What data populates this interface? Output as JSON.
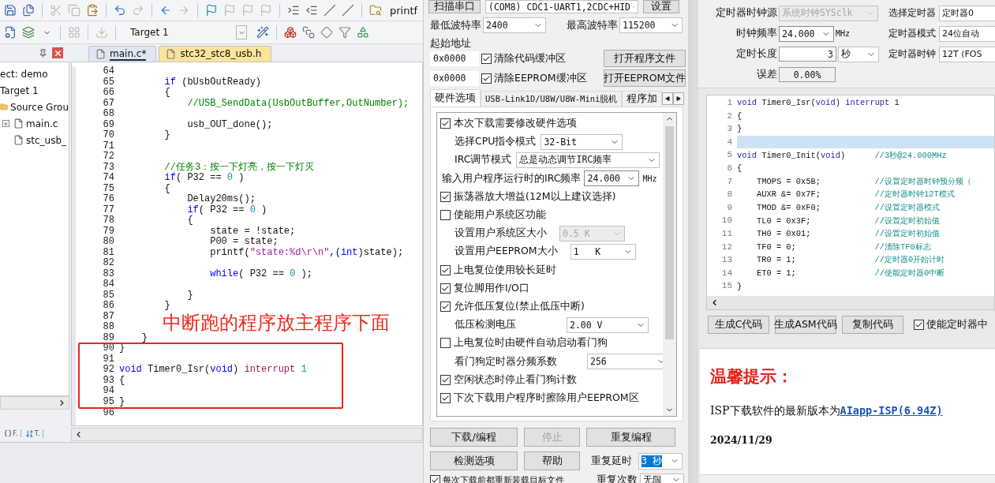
{
  "ide": {
    "toolbar_1": {
      "buttons": [
        {
          "disabled": false
        },
        {
          "disabled": false
        },
        {
          "disabled": true
        },
        {
          "disabled": true
        },
        {
          "disabled": false
        },
        {
          "disabled": false
        },
        {
          "disabled": true
        },
        {
          "disabled": false
        },
        {
          "disabled": true
        },
        {
          "disabled": false
        },
        {
          "disabled": true
        },
        {
          "disabled": true
        },
        {
          "disabled": true
        },
        {
          "disabled": false
        },
        {
          "disabled": false
        },
        {
          "disabled": false
        },
        {
          "disabled": false
        },
        {
          "disabled": false
        }
      ],
      "find_text": "printf"
    },
    "toolbar_2": {
      "buttons": [
        {
          "disabled": false
        },
        {
          "disabled": false
        },
        {
          "disabled": false
        },
        {
          "disabled": true
        },
        {
          "disabled": true
        },
        {
          "disabled": false
        },
        {
          "disabled": false
        },
        {
          "disabled": false
        },
        {
          "disabled": false
        },
        {
          "disabled": false
        },
        {
          "disabled": false
        }
      ],
      "target": "Target 1"
    },
    "project_tree": [
      {
        "label": "ect: demo",
        "children": [
          {
            "label": "Target 1",
            "children": [
              {
                "label": "Source Grou",
                "kind": "folder",
                "children": [
                  {
                    "label": "main.c",
                    "kind": "file",
                    "expandable": true
                  },
                  {
                    "label": "stc_usb_",
                    "kind": "file",
                    "expandable": false
                  }
                ]
              }
            ]
          }
        ]
      }
    ],
    "panel_tabs": [
      {
        "label": "F.",
        "kind": "functions"
      },
      {
        "label": "T.",
        "kind": "templates"
      }
    ],
    "editor_tabs": [
      {
        "label": "main.c*",
        "selected": true,
        "color": "#dfe6f2"
      },
      {
        "label": "stc32_stc8_usb.h",
        "selected": false,
        "color": "#fbe39a"
      }
    ],
    "code": [
      {
        "num": "64"
      },
      {
        "num": "65",
        "tokens": [
          {
            "kind": "kw",
            "text": "        if"
          },
          {
            "kind": "plain",
            "text": " (bUsbOutReady)"
          }
        ]
      },
      {
        "num": "66",
        "tokens": [
          {
            "kind": "plain",
            "text": "        {"
          }
        ]
      },
      {
        "num": "67",
        "tokens": [
          {
            "kind": "comment",
            "text": "            //USB_SendData(UsbOutBuffer,OutNumber);"
          }
        ]
      },
      {
        "num": "68"
      },
      {
        "num": "69",
        "tokens": [
          {
            "kind": "plain",
            "text": "            usb_OUT_done();"
          }
        ]
      },
      {
        "num": "70",
        "tokens": [
          {
            "kind": "plain",
            "text": "        }"
          }
        ]
      },
      {
        "num": "71"
      },
      {
        "num": "72"
      },
      {
        "num": "73",
        "tokens": [
          {
            "kind": "comment",
            "text": "        //任务3：按一下灯亮，按一下灯灭"
          }
        ]
      },
      {
        "num": "74",
        "tokens": [
          {
            "kind": "kw",
            "text": "        if"
          },
          {
            "kind": "plain",
            "text": "( P32 == "
          },
          {
            "kind": "num",
            "text": "0"
          },
          {
            "kind": "plain",
            "text": " )"
          }
        ]
      },
      {
        "num": "75",
        "tokens": [
          {
            "kind": "plain",
            "text": "        {"
          }
        ]
      },
      {
        "num": "76",
        "tokens": [
          {
            "kind": "plain",
            "text": "            Delay20ms();"
          }
        ]
      },
      {
        "num": "77",
        "tokens": [
          {
            "kind": "kw",
            "text": "            if"
          },
          {
            "kind": "plain",
            "text": "( P32 == "
          },
          {
            "kind": "num",
            "text": "0"
          },
          {
            "kind": "plain",
            "text": " )"
          }
        ]
      },
      {
        "num": "78",
        "tokens": [
          {
            "kind": "plain",
            "text": "            {"
          }
        ]
      },
      {
        "num": "79",
        "tokens": [
          {
            "kind": "plain",
            "text": "                state = !state;"
          }
        ]
      },
      {
        "num": "80",
        "tokens": [
          {
            "kind": "plain",
            "text": "                P00 = state;"
          }
        ]
      },
      {
        "num": "81",
        "tokens": [
          {
            "kind": "plain",
            "text": "                printf("
          },
          {
            "kind": "str",
            "text": "\"state:%d\\r\\n\""
          },
          {
            "kind": "plain",
            "text": ",("
          },
          {
            "kind": "kw",
            "text": "int"
          },
          {
            "kind": "plain",
            "text": ")state);"
          }
        ]
      },
      {
        "num": "82"
      },
      {
        "num": "83",
        "tokens": [
          {
            "kind": "kw",
            "text": "                while"
          },
          {
            "kind": "plain",
            "text": "( P32 == "
          },
          {
            "kind": "num",
            "text": "0"
          },
          {
            "kind": "plain",
            "text": " );"
          }
        ]
      },
      {
        "num": "84"
      },
      {
        "num": "85",
        "tokens": [
          {
            "kind": "plain",
            "text": "            }"
          }
        ]
      },
      {
        "num": "86",
        "tokens": [
          {
            "kind": "plain",
            "text": "        }"
          }
        ]
      },
      {
        "num": "87"
      },
      {
        "num": "88"
      },
      {
        "num": "89",
        "tokens": [
          {
            "kind": "plain",
            "text": "    }"
          }
        ]
      },
      {
        "num": "90",
        "tokens": [
          {
            "kind": "plain",
            "text": "}"
          }
        ]
      },
      {
        "num": "91"
      },
      {
        "num": "92",
        "tokens": [
          {
            "kind": "kw",
            "text": "void"
          },
          {
            "kind": "plain",
            "text": " Timer0_Isr("
          },
          {
            "kind": "kw",
            "text": "void"
          },
          {
            "kind": "plain",
            "text": ") "
          },
          {
            "kind": "kw2",
            "text": "interrupt"
          },
          {
            "kind": "num",
            "text": " 1"
          }
        ]
      },
      {
        "num": "93",
        "tokens": [
          {
            "kind": "plain",
            "text": "{"
          }
        ]
      },
      {
        "num": "94"
      },
      {
        "num": "95",
        "tokens": [
          {
            "kind": "plain",
            "text": "}"
          }
        ]
      },
      {
        "num": "96"
      }
    ],
    "annotation": "中断跑的程序放主程序下面"
  },
  "isp": {
    "scan_button": "扫描串口",
    "port": "(COM8) CDC1-UART1,2CDC+HID",
    "settings_button": "设置",
    "min_baud_label": "最低波特率",
    "min_baud": "2400",
    "max_baud_label": "最高波特率",
    "max_baud": "115200",
    "start_address_label": "起始地址",
    "address_rows": [
      {
        "address": "0x0000",
        "option": "清除代码缓冲区",
        "checked": true,
        "button": "打开程序文件"
      },
      {
        "address": "0x0000",
        "option": "清除EEPROM缓冲区",
        "checked": true,
        "button": "打开EEPROM文件"
      }
    ],
    "tabs": [
      {
        "label": "硬件选项",
        "selected": true
      },
      {
        "label": "USB-Link1D/U8W/U8W-Mini脱机",
        "selected": false
      },
      {
        "label": "程序加",
        "selected": false
      }
    ],
    "options": [
      {
        "kind": "checkbox",
        "label": "本次下载需要修改硬件选项",
        "checked": true
      },
      {
        "kind": "select",
        "label": "选择CPU指令模式",
        "value": "32-Bit",
        "disabled": false
      },
      {
        "kind": "select",
        "label": "IRC调节模式",
        "value": "总是动态调节IRC频率",
        "disabled": false
      },
      {
        "kind": "combo",
        "label": "输入用户程序运行时的IRC频率",
        "value": "24.000",
        "unit": "MHz"
      },
      {
        "kind": "checkbox",
        "label": "振荡器放大增益(12M以上建议选择)",
        "checked": true
      },
      {
        "kind": "checkbox",
        "label": "使能用户系统区功能",
        "checked": false
      },
      {
        "kind": "select",
        "label": "设置用户系统区大小",
        "value": "0.5 K",
        "disabled": true
      },
      {
        "kind": "select",
        "label": "设置用户EEPROM大小",
        "value": "1   K",
        "disabled": false
      },
      {
        "kind": "checkbox",
        "label": "上电复位使用较长延时",
        "checked": true
      },
      {
        "kind": "checkbox",
        "label": "复位脚用作I/O口",
        "checked": true
      },
      {
        "kind": "checkbox",
        "label": "允许低压复位(禁止低压中断)",
        "checked": true
      },
      {
        "kind": "select",
        "label": "低压检测电压",
        "value": "2.00 V",
        "disabled": false
      },
      {
        "kind": "checkbox",
        "label": "上电复位时由硬件自动启动看门狗",
        "checked": false
      },
      {
        "kind": "select",
        "label": "看门狗定时器分频系数",
        "value": "256",
        "disabled": false
      },
      {
        "kind": "checkbox",
        "label": "空闲状态时停止看门狗计数",
        "checked": true
      },
      {
        "kind": "checkbox",
        "label": "下次下载用户程序时擦除用户EEPROM区",
        "checked": true
      }
    ],
    "buttons": [
      {
        "label": "下载/编程",
        "disabled": false
      },
      {
        "label": "停止",
        "disabled": true
      },
      {
        "label": "重复编程",
        "disabled": false
      },
      {
        "label": "检测选项",
        "disabled": false
      },
      {
        "label": "帮助",
        "disabled": false
      }
    ],
    "repeat_delay": {
      "label": "重复延时",
      "value": "3 秒",
      "highlighted": true
    },
    "reload_option": {
      "label": "每次下载前都重新装载目标文件",
      "checked": true
    },
    "repeat_count": {
      "label": "重复次数",
      "value": "无限"
    }
  },
  "timer": {
    "fields_left": [
      {
        "kind": "select",
        "label": "定时器时钟源",
        "value": "系统时钟SYSclk",
        "disabled": true
      },
      {
        "kind": "combo",
        "label": "时钟频率",
        "value": "24.000",
        "unit": "MHz"
      },
      {
        "kind": "length",
        "label": "定时长度",
        "value": "3",
        "unit": "秒"
      },
      {
        "kind": "readout",
        "label": "误差",
        "value": "0.00%"
      }
    ],
    "fields_right": [
      {
        "label": "选择定时器",
        "value": "定时器0"
      },
      {
        "label": "定时器模式",
        "value": "24位自动"
      },
      {
        "label": "定时器时钟",
        "value": "12T (FOS"
      }
    ],
    "code": [
      {
        "num": "1",
        "highlighted": false,
        "tokens": [
          {
            "kind": "kw",
            "text": "void"
          },
          {
            "kind": "plain",
            "text": " Timer0_Isr("
          },
          {
            "kind": "kw",
            "text": "void"
          },
          {
            "kind": "plain",
            "text": ") "
          },
          {
            "kind": "kw",
            "text": "interrupt"
          },
          {
            "kind": "plain",
            "text": " 1"
          }
        ]
      },
      {
        "num": "2",
        "highlighted": false,
        "tokens": [
          {
            "kind": "plain",
            "text": "{"
          }
        ]
      },
      {
        "num": "3",
        "highlighted": false,
        "tokens": [
          {
            "kind": "plain",
            "text": "}"
          }
        ]
      },
      {
        "num": "4",
        "highlighted": true
      },
      {
        "num": "5",
        "highlighted": false,
        "tokens": [
          {
            "kind": "kw",
            "text": "void"
          },
          {
            "kind": "plain",
            "text": " Timer0_Init("
          },
          {
            "kind": "kw",
            "text": "void"
          },
          {
            "kind": "plain",
            "text": ")      "
          },
          {
            "kind": "comment",
            "text": "//3秒@24.000MHz"
          }
        ]
      },
      {
        "num": "6",
        "highlighted": false,
        "tokens": [
          {
            "kind": "plain",
            "text": "{"
          }
        ]
      },
      {
        "num": "7",
        "highlighted": false,
        "tokens": [
          {
            "kind": "plain",
            "text": "    TMOPS = 0x5B;           "
          },
          {
            "kind": "comment",
            "text": "//设置定时器时钟预分频（"
          }
        ]
      },
      {
        "num": "8",
        "highlighted": false,
        "tokens": [
          {
            "kind": "plain",
            "text": "    AUXR &= 0x7F;           "
          },
          {
            "kind": "comment",
            "text": "//定时器时钟12T模式"
          }
        ]
      },
      {
        "num": "9",
        "highlighted": false,
        "tokens": [
          {
            "kind": "plain",
            "text": "    TMOD &= 0xF0;           "
          },
          {
            "kind": "comment",
            "text": "//设置定时器模式"
          }
        ]
      },
      {
        "num": "10",
        "highlighted": false,
        "tokens": [
          {
            "kind": "plain",
            "text": "    TL0 = 0x3F;             "
          },
          {
            "kind": "comment",
            "text": "//设置定时初始值"
          }
        ]
      },
      {
        "num": "11",
        "highlighted": false,
        "tokens": [
          {
            "kind": "plain",
            "text": "    TH0 = 0x01;             "
          },
          {
            "kind": "comment",
            "text": "//设置定时初始值"
          }
        ]
      },
      {
        "num": "12",
        "highlighted": false,
        "tokens": [
          {
            "kind": "plain",
            "text": "    TF0 = 0;                "
          },
          {
            "kind": "comment",
            "text": "//清除TF0标志"
          }
        ]
      },
      {
        "num": "13",
        "highlighted": false,
        "tokens": [
          {
            "kind": "plain",
            "text": "    TR0 = 1;                "
          },
          {
            "kind": "comment",
            "text": "//定时器0开始计时"
          }
        ]
      },
      {
        "num": "14",
        "highlighted": false,
        "tokens": [
          {
            "kind": "plain",
            "text": "    ET0 = 1;                "
          },
          {
            "kind": "comment",
            "text": "//使能定时器0中断"
          }
        ]
      },
      {
        "num": "15",
        "highlighted": false,
        "tokens": [
          {
            "kind": "plain",
            "text": "}"
          }
        ]
      }
    ],
    "buttons": [
      "生成C代码",
      "生成ASM代码",
      "复制代码"
    ],
    "enable_interrupt": {
      "label": "使能定时器中",
      "checked": true
    }
  },
  "notice": {
    "title": "温馨提示：",
    "message": "ISP下载软件的最新版本为",
    "link": "AIapp-ISP(6.94Z)",
    "date": "2024/11/29"
  }
}
